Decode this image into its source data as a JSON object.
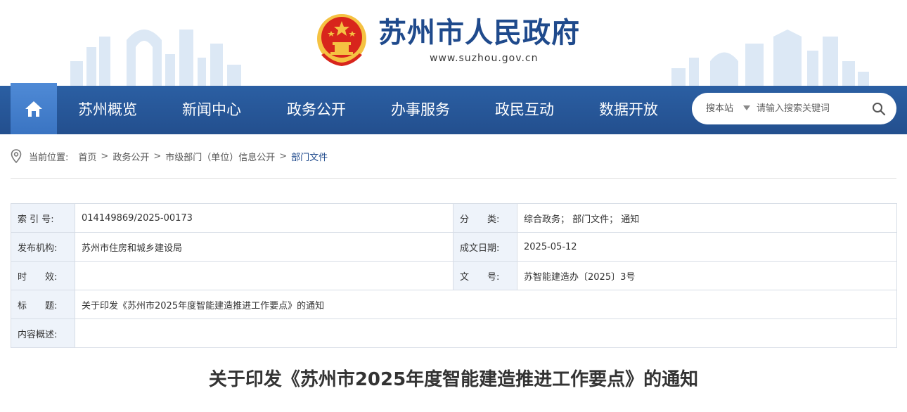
{
  "header": {
    "title": "苏州市人民政府",
    "url": "www.suzhou.gov.cn",
    "emblem_icon": "national-emblem-icon"
  },
  "nav": {
    "home_icon": "home-icon",
    "items": [
      "苏州概览",
      "新闻中心",
      "政务公开",
      "办事服务",
      "政民互动",
      "数据开放"
    ],
    "search_scope": "搜本站",
    "search_placeholder": "请输入搜索关键词",
    "search_icon": "search-icon"
  },
  "breadcrumb": {
    "prefix": "当前位置:",
    "items": [
      "首页",
      "政务公开",
      "市级部门（单位）信息公开",
      "部门文件"
    ],
    "separator": ">"
  },
  "info": {
    "index_label": "索 引 号:",
    "index_value": "014149869/2025-00173",
    "category_label": "分　　类:",
    "category_value": "综合政务；  部门文件；  通知",
    "publisher_label": "发布机构:",
    "publisher_value": "苏州市住房和城乡建设局",
    "date_label": "成文日期:",
    "date_value": "2025-05-12",
    "validity_label": "时　　效:",
    "validity_value": "",
    "docno_label": "文　　号:",
    "docno_value": "苏智能建造办〔2025〕3号",
    "title_label": "标　　题:",
    "title_value": "关于印发《苏州市2025年度智能建造推进工作要点》的通知",
    "summary_label": "内容概述:",
    "summary_value": ""
  },
  "article": {
    "title": "关于印发《苏州市2025年度智能建造推进工作要点》的通知"
  },
  "colors": {
    "nav_bg": "#2b5fa3",
    "home_bg": "#4f8ad6",
    "title_blue": "#1f4a8c",
    "label_bg": "#eef3fa",
    "emblem_red": "#d8251c",
    "emblem_gold": "#f5c242"
  }
}
